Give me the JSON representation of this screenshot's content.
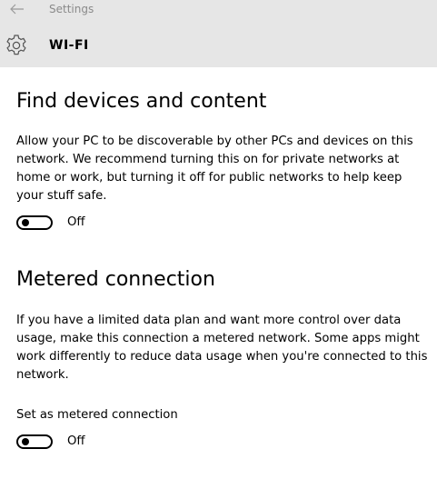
{
  "window": {
    "title": "Settings",
    "back_icon": "back-arrow-icon"
  },
  "header": {
    "icon": "gear-icon",
    "title": "WI-FI"
  },
  "find_devices": {
    "title": "Find devices and content",
    "description": "Allow your PC to be discoverable by other PCs and devices on this network. We recommend turning this on for private networks at home or work, but turning it off for public networks to help keep your stuff safe.",
    "toggle_state": "Off"
  },
  "metered": {
    "title": "Metered connection",
    "description": "If you have a limited data plan and want more control over data usage, make this connection a metered network. Some apps might work differently to reduce data usage when you're connected to this network.",
    "setting_label": "Set as metered connection",
    "toggle_state": "Off"
  },
  "colors": {
    "header_bg": "#e6e6e6",
    "title_text_muted": "#8a8a8a",
    "toggle": "#000000"
  }
}
